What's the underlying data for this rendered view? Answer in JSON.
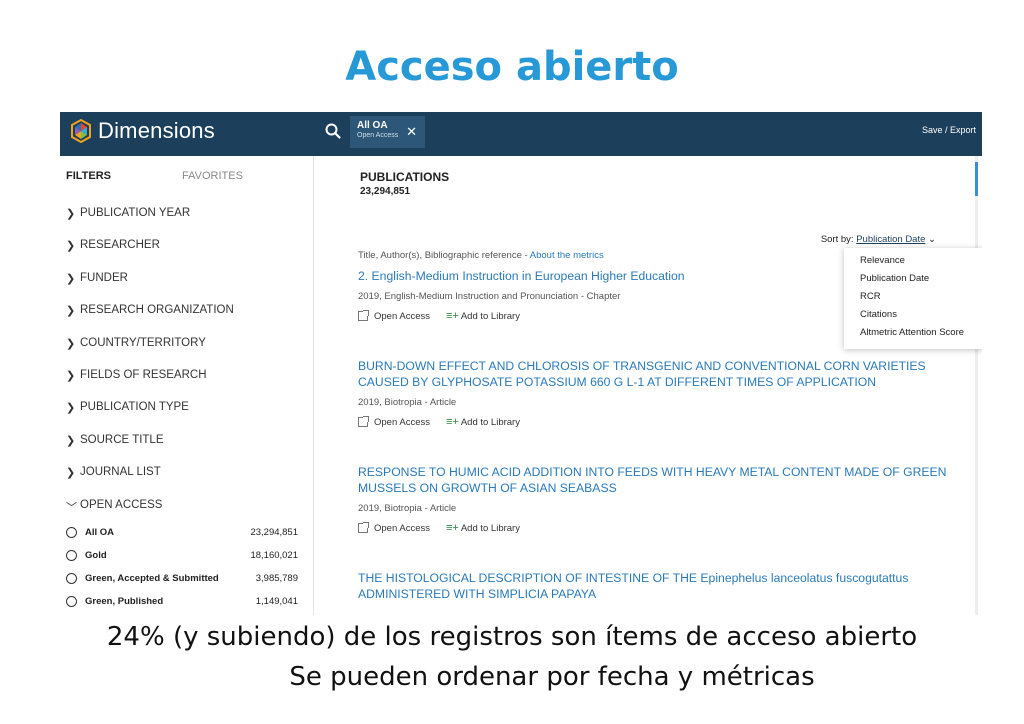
{
  "slide": {
    "title": "Acceso abierto",
    "caption_1": "24% (y subiendo) de los registros son ítems de acceso abierto",
    "caption_2": "Se pueden ordenar por fecha y métricas"
  },
  "app": {
    "logo_text": "Dimensions",
    "search_icon": "search-icon",
    "filter_chip": {
      "title": "All OA",
      "subtitle": "Open Access",
      "close": "✕"
    },
    "save_export": "Save / Export",
    "colors": {
      "topbar": "#1c3f5b",
      "accent": "#2a7ab8",
      "title_blue": "#2699d6"
    }
  },
  "sidebar": {
    "tabs": [
      "FILTERS",
      "FAVORITES"
    ],
    "filters": [
      {
        "label": "PUBLICATION YEAR",
        "chevron": "❯"
      },
      {
        "label": "RESEARCHER",
        "chevron": "❯"
      },
      {
        "label": "FUNDER",
        "chevron": "❯"
      },
      {
        "label": "RESEARCH ORGANIZATION",
        "chevron": "❯"
      },
      {
        "label": "COUNTRY/TERRITORY",
        "chevron": "❯"
      },
      {
        "label": "FIELDS OF RESEARCH",
        "chevron": "❯"
      },
      {
        "label": "PUBLICATION TYPE",
        "chevron": "❯"
      },
      {
        "label": "SOURCE TITLE",
        "chevron": "❯"
      },
      {
        "label": "JOURNAL LIST",
        "chevron": "❯"
      },
      {
        "label": "OPEN ACCESS",
        "chevron": "﹀"
      }
    ],
    "open_access_options": [
      {
        "label": "All OA",
        "count": "23,294,851"
      },
      {
        "label": "Gold",
        "count": "18,160,021"
      },
      {
        "label": "Green, Accepted & Submitted",
        "count": "3,985,789"
      },
      {
        "label": "Green, Published",
        "count": "1,149,041"
      }
    ]
  },
  "main": {
    "heading": "PUBLICATIONS",
    "count": "23,294,851",
    "sort_label": "Sort by:",
    "sort_value": "Publication Date",
    "sort_options": [
      "Relevance",
      "Publication Date",
      "RCR",
      "Citations",
      "Altmetric Attention Score"
    ],
    "meta_text": "Title, Author(s), Bibliographic reference - ",
    "meta_link": "About the metrics",
    "open_access_label": "Open Access",
    "add_library_label": "Add to Library",
    "results": [
      {
        "title": "2. English-Medium Instruction in European Higher Education",
        "sub": "2019, English-Medium Instruction and Pronunciation - Chapter"
      },
      {
        "title": "BURN-DOWN EFFECT AND CHLOROSIS OF TRANSGENIC AND CONVENTIONAL CORN VARIETIES CAUSED BY GLYPHOSATE POTASSIUM 660 G L-1 AT DIFFERENT TIMES OF APPLICATION",
        "sub": "2019, Biotropia - Article"
      },
      {
        "title": "RESPONSE TO HUMIC ACID ADDITION INTO FEEDS WITH HEAVY METAL CONTENT MADE OF GREEN MUSSELS ON GROWTH OF ASIAN SEABASS",
        "sub": "2019, Biotropia - Article"
      },
      {
        "title": "THE HISTOLOGICAL DESCRIPTION OF INTESTINE OF THE Epinephelus lanceolatus fuscogutattus ADMINISTERED WITH SIMPLICIA PAPAYA",
        "sub": ""
      }
    ]
  }
}
